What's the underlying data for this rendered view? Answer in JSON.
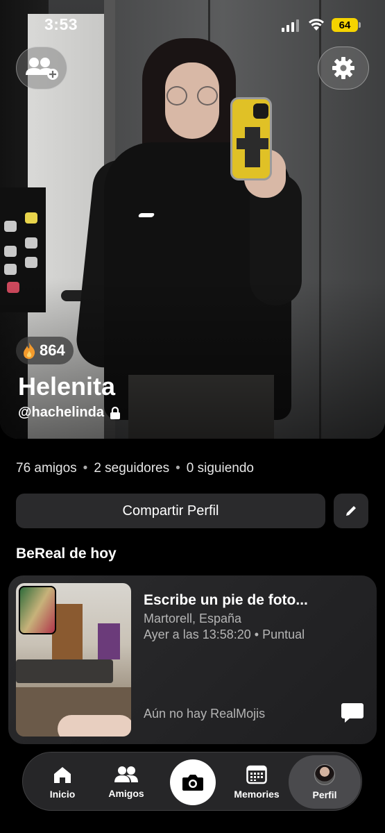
{
  "status_bar": {
    "time": "3:53",
    "battery": "64"
  },
  "profile": {
    "streak_count": "864",
    "display_name": "Helenita",
    "username": "@hachelinda",
    "stats": {
      "friends": "76 amigos",
      "followers": "2 seguidores",
      "following": "0 siguiendo",
      "separator": "•"
    },
    "share_label": "Compartir Perfil"
  },
  "today_section": {
    "title": "BeReal de hoy",
    "card": {
      "caption_placeholder": "Escribe un pie de foto...",
      "location": "Martorell, España",
      "time": "Ayer a las 13:58:20 • Puntual",
      "realmojis": "Aún no hay RealMojis"
    }
  },
  "tab_bar": {
    "items": [
      {
        "label": "Inicio",
        "icon": "home-icon"
      },
      {
        "label": "Amigos",
        "icon": "friends-icon"
      },
      {
        "label": "",
        "icon": "camera-icon"
      },
      {
        "label": "Memories",
        "icon": "calendar-icon"
      },
      {
        "label": "Perfil",
        "icon": "avatar"
      }
    ]
  },
  "colors": {
    "background": "#000000",
    "card": "#2a2a2c",
    "battery": "#f5d300",
    "muted_text": "#b5b5b5"
  }
}
